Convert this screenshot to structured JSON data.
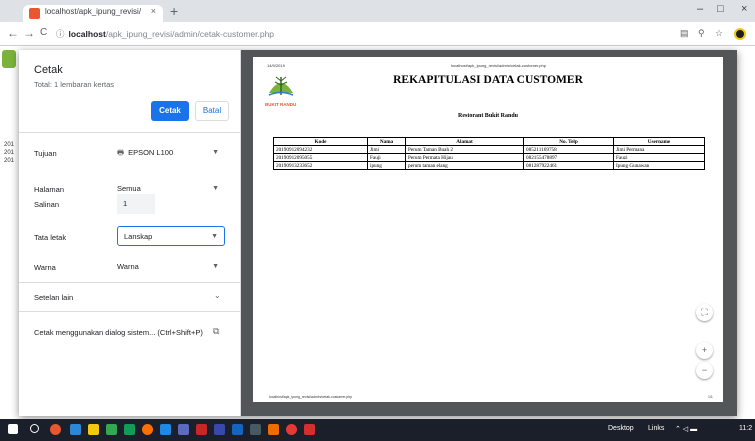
{
  "browser": {
    "tab_title": "localhost/apk_ipung_revisi/admi",
    "tab_close": "×",
    "new_tab": "+",
    "url_host": "localhost",
    "url_path": "/apk_ipung_revisi/admin/cetak-customer.php",
    "info_icon": "ⓘ",
    "back": "←",
    "forward": "→",
    "reload": "C",
    "minimize": "–",
    "maximize": "□",
    "close": "×"
  },
  "background_page": {
    "fragments": [
      "201",
      "201",
      "201"
    ]
  },
  "print_panel": {
    "title": "Cetak",
    "total": "Total: 1 lembaran kertas",
    "print_button": "Cetak",
    "cancel_button": "Batal",
    "destination_label": "Tujuan",
    "destination_value": "EPSON L100",
    "pages_label": "Halaman",
    "pages_value": "Semua",
    "copies_label": "Salinan",
    "copies_value": "1",
    "layout_label": "Tata letak",
    "layout_value": "Lanskap",
    "color_label": "Warna",
    "color_value": "Warna",
    "more_settings": "Setelan lain",
    "system_dialog": "Cetak menggunakan dialog sistem... (Ctrl+Shift+P)"
  },
  "preview": {
    "date": "14/9/2019",
    "header_url": "localhost/apk_ipung_revisi/admin/cetak-customer.php",
    "report_title": "REKAPITULASI DATA CUSTOMER",
    "logo_text": "BUKIT RANDU",
    "subtitle": "Restorant Bukit Randu",
    "table": {
      "headers": [
        "Kode",
        "Nama",
        "Alamat",
        "No. Telp",
        "Username"
      ],
      "rows": [
        [
          "20190912094232",
          "Jimi",
          "Perum Taman Buah 2",
          "085211169758",
          "Jimi Permana"
        ],
        [
          "20190912095055",
          "Fauji",
          "Perum Permata Hijau",
          "082155478897",
          "Fauzi"
        ],
        [
          "20190913233652",
          "ipung",
          "perum taman elang",
          "081287922461",
          "Ipung Gunawan"
        ]
      ]
    },
    "footer_url": "localhost/apk_ipung_revisi/admin/cetak-customer.php",
    "page_num": "1/1"
  },
  "zoom": {
    "fit": "⛶",
    "zoom_in": "+",
    "zoom_out": "−"
  },
  "taskbar": {
    "desktop": "Desktop",
    "links": "Links",
    "time": "11:2"
  },
  "colors": {
    "accent": "#1a73e8",
    "preview_bg": "#525659",
    "taskbar": "#1b1f2a"
  }
}
